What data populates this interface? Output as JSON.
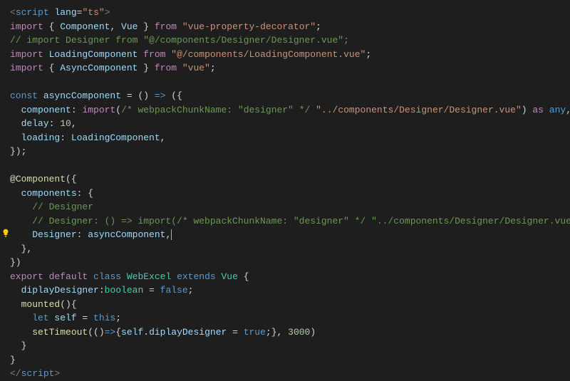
{
  "code": {
    "l1_open": "<",
    "l1_tag": "script",
    "l1_attr": "lang",
    "l1_eq": "=",
    "l1_val": "\"ts\"",
    "l1_close": ">",
    "l2_import": "import",
    "l2_brace_o": " { ",
    "l2_comp": "Component",
    "l2_comma": ", ",
    "l2_vue": "Vue",
    "l2_brace_c": " } ",
    "l2_from": "from",
    "l2_str": " \"vue-property-decorator\"",
    "l2_semi": ";",
    "l3_cmt": "// import Designer from \"@/components/Designer/Designer.vue\";",
    "l4_import": "import",
    "l4_sp": " ",
    "l4_id": "LoadingComponent",
    "l4_from": " from",
    "l4_str": " \"@/components/LoadingComponent.vue\"",
    "l4_semi": ";",
    "l5_import": "import",
    "l5_brace_o": " { ",
    "l5_id": "AsyncComponent",
    "l5_brace_c": " } ",
    "l5_from": "from",
    "l5_str": " \"vue\"",
    "l5_semi": ";",
    "l7_const": "const",
    "l7_id": " asyncComponent",
    "l7_eq": " = () ",
    "l7_arrow": "=>",
    "l7_paren": " ({",
    "l8_key": "  component",
    "l8_colon": ": ",
    "l8_fn": "import",
    "l8_paren_o": "(",
    "l8_cmt": "/* webpackChunkName: \"designer\" */",
    "l8_str": " \"../components/Designer/Designer.vue\"",
    "l8_paren_c": ") ",
    "l8_as": "as",
    "l8_any": " any",
    "l8_comma": ",",
    "l9_key": "  delay",
    "l9_colon": ": ",
    "l9_num": "10",
    "l9_comma": ",",
    "l10_key": "  loading",
    "l10_colon": ": ",
    "l10_val": "LoadingComponent",
    "l10_comma": ",",
    "l11_close": "});",
    "l13_deco": "@",
    "l13_fn": "Component",
    "l13_open": "({",
    "l14_key": "  components",
    "l14_colon": ": {",
    "l15_cmt": "    // Designer",
    "l16_cmt": "    // Designer: () => import(/* webpackChunkName: \"designer\" */ \"../components/Designer/Designer.vue\"),",
    "l17_key": "    Designer",
    "l17_colon": ": ",
    "l17_val": "asyncComponent",
    "l17_comma": ",",
    "l18_close": "  },",
    "l19_close": "})",
    "l20_export": "export",
    "l20_default": " default",
    "l20_class": " class",
    "l20_name": " WebExcel",
    "l20_extends": " extends",
    "l20_vue": " Vue",
    "l20_brace": " {",
    "l21_key": "  diplayDesigner",
    "l21_colon": ":",
    "l21_type": "boolean",
    "l21_eq": " = ",
    "l21_val": "false",
    "l21_semi": ";",
    "l22_fn": "  mounted",
    "l22_paren": "(){",
    "l23_let": "    let",
    "l23_id": " self",
    "l23_eq": " = ",
    "l23_this": "this",
    "l23_semi": ";",
    "l24_fn": "    setTimeout",
    "l24_open": "(()",
    "l24_arrow": "=>",
    "l24_brace_o": "{",
    "l24_self": "self",
    "l24_dot": ".",
    "l24_prop": "diplayDesigner",
    "l24_eq": " = ",
    "l24_true": "true",
    "l24_semi": ";}, ",
    "l24_num": "3000",
    "l24_close": ")",
    "l25_close": "  }",
    "l26_close": "}",
    "l27_open": "</",
    "l27_tag": "script",
    "l27_close": ">"
  }
}
